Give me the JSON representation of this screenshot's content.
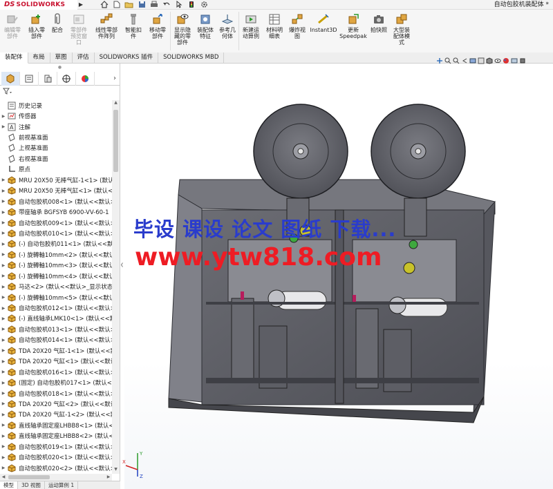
{
  "app": {
    "brand_prefix": "DS",
    "brand_name": "SOLIDWORKS",
    "document_title": "自动包胶机装配体 *"
  },
  "quick_tools": [
    "home-icon",
    "new-file-icon",
    "open-icon",
    "save-icon",
    "print-icon",
    "undo-icon",
    "select-arrow-icon",
    "rebuild-icon",
    "options-icon"
  ],
  "ribbon": {
    "buttons": [
      {
        "id": "edit-component",
        "label": "编辑零\n部件",
        "disabled": true
      },
      {
        "id": "insert-component",
        "label": "插入零\n部件",
        "disabled": false
      },
      {
        "id": "mate",
        "label": "配合",
        "disabled": false
      },
      {
        "id": "component-preview",
        "label": "零部件\n预览窗\n口",
        "disabled": true
      },
      {
        "id": "linear-pattern",
        "label": "线性零部\n件阵列",
        "disabled": false
      },
      {
        "id": "smart-fasteners",
        "label": "智能扣\n件",
        "disabled": false
      },
      {
        "id": "move-component",
        "label": "移动零\n部件",
        "disabled": false
      },
      {
        "id": "show-hidden",
        "label": "显示隐\n藏的零\n部件",
        "disabled": false
      },
      {
        "id": "assembly-features",
        "label": "装配体\n特征",
        "disabled": false
      },
      {
        "id": "reference-geometry",
        "label": "参考几\n何体",
        "disabled": false
      },
      {
        "id": "new-motion-study",
        "label": "新建运\n动算例",
        "disabled": false
      },
      {
        "id": "bill-of-materials",
        "label": "材料明\n细表",
        "disabled": false
      },
      {
        "id": "exploded-view",
        "label": "爆炸视\n图",
        "disabled": false
      },
      {
        "id": "instant3d",
        "label": "Instant3D",
        "disabled": false
      },
      {
        "id": "update-speedpak",
        "label": "更新\nSpeedpak",
        "disabled": false
      },
      {
        "id": "snapshot",
        "label": "拍快照",
        "disabled": false
      },
      {
        "id": "large-assembly-mode",
        "label": "大型装\n配体模\n式",
        "disabled": false
      }
    ]
  },
  "tabs": [
    {
      "label": "装配体",
      "active": true
    },
    {
      "label": "布局",
      "active": false
    },
    {
      "label": "草图",
      "active": false
    },
    {
      "label": "评估",
      "active": false
    },
    {
      "label": "SOLIDWORKS 插件",
      "active": false
    },
    {
      "label": "SOLIDWORKS MBD",
      "active": false
    }
  ],
  "panel_tabs": [
    "featuremanager-icon",
    "propertymanager-icon",
    "configurationmanager-icon",
    "dimxpert-icon",
    "display-manager-icon"
  ],
  "tree": {
    "items": [
      {
        "label": "历史记录",
        "icon": "history-icon",
        "expand": false
      },
      {
        "label": "传感器",
        "icon": "sensor-icon",
        "expand": true
      },
      {
        "label": "注解",
        "icon": "annotation-icon",
        "expand": true
      },
      {
        "label": "前视基准面",
        "icon": "plane-icon",
        "expand": false
      },
      {
        "label": "上视基准面",
        "icon": "plane-icon",
        "expand": false
      },
      {
        "label": "右视基准面",
        "icon": "plane-icon",
        "expand": false
      },
      {
        "label": "原点",
        "icon": "origin-icon",
        "expand": false
      },
      {
        "label": "MRU 20X50  无棒气缸-1<1> (默认",
        "icon": "part-icon",
        "expand": true
      },
      {
        "label": "MRU 20X50  无棒气缸<1> (默认<",
        "icon": "part-icon",
        "expand": true
      },
      {
        "label": "自动包胶机008<1> (默认<<默认>",
        "icon": "part-icon",
        "expand": true
      },
      {
        "label": "带座轴承 BGFSYB 6900-VV-60-1",
        "icon": "part-icon",
        "expand": true
      },
      {
        "label": "自动包胶机009<1> (默认<<默认>",
        "icon": "part-icon",
        "expand": true
      },
      {
        "label": "自动包胶机010<1> (默认<<默认>",
        "icon": "part-icon",
        "expand": true
      },
      {
        "label": "(-) 自动包胶机011<1> (默认<<默",
        "icon": "part-icon",
        "expand": true
      },
      {
        "label": "(-) 旋轉軸10mm<2> (默认<<默认",
        "icon": "part-icon",
        "expand": true
      },
      {
        "label": "(-) 旋轉軸10mm<3> (默认<<默认",
        "icon": "part-icon",
        "expand": true
      },
      {
        "label": "(-) 旋轉軸10mm<4> (默认<<默认",
        "icon": "part-icon",
        "expand": true
      },
      {
        "label": "马达<2> (默认<<默认>_显示状态",
        "icon": "part-icon",
        "expand": true
      },
      {
        "label": "(-) 旋轉軸10mm<5> (默认<<默认",
        "icon": "part-icon",
        "expand": true
      },
      {
        "label": "自动包胶机012<1> (默认<<默认>",
        "icon": "part-icon",
        "expand": true
      },
      {
        "label": "(-) 直线轴承LMK10<1> (默认<<默",
        "icon": "part-icon",
        "expand": true
      },
      {
        "label": "自动包胶机013<1> (默认<<默认>",
        "icon": "part-icon",
        "expand": true
      },
      {
        "label": "自动包胶机014<1> (默认<<默认>",
        "icon": "part-icon",
        "expand": true
      },
      {
        "label": "TDA 20X20 气缸-1<1> (默认<<默",
        "icon": "part-icon",
        "expand": true
      },
      {
        "label": "TDA 20X20 气缸<1> (默认<<默认",
        "icon": "part-icon",
        "expand": true
      },
      {
        "label": "自动包胶机016<1> (默认<<默认>",
        "icon": "part-icon",
        "expand": true
      },
      {
        "label": "(固定) 自动包胶机017<1> (默认<<",
        "icon": "part-icon",
        "expand": true
      },
      {
        "label": "自动包胶机018<1> (默认<<默认>",
        "icon": "part-icon",
        "expand": true
      },
      {
        "label": "TDA 20X20 气缸<2> (默认<<默认",
        "icon": "part-icon",
        "expand": true
      },
      {
        "label": "TDA 20X20 气缸-1<2> (默认<<默",
        "icon": "part-icon",
        "expand": true
      },
      {
        "label": "直线轴承固定座LHBB8<1> (默认<<",
        "icon": "part-icon",
        "expand": true
      },
      {
        "label": "直线轴承固定座LHBB8<2> (默认<<",
        "icon": "part-icon",
        "expand": true
      },
      {
        "label": "自动包胶机019<1> (默认<<默认>",
        "icon": "part-icon",
        "expand": true
      },
      {
        "label": "自动包胶机020<1> (默认<<默认>",
        "icon": "part-icon",
        "expand": true
      },
      {
        "label": "自动包胶机020<2> (默认<<默认>",
        "icon": "part-icon",
        "expand": true
      }
    ]
  },
  "bottom_tabs": [
    {
      "label": "模型",
      "active": true
    },
    {
      "label": "3D 视图",
      "active": false
    },
    {
      "label": "运动算例 1",
      "active": false
    }
  ],
  "watermark": {
    "line1": "毕设 课设 论文 图纸 下载...",
    "line2": "www.ytw818.com",
    "color1": "#2a3ccc",
    "color2": "#ee1c24"
  },
  "triad": {
    "x_label": "X",
    "y_label": "Y",
    "z_label": "Z"
  },
  "colors": {
    "brand": "#c8102e",
    "model_body": "#5e5f66",
    "selection_blue": "#dde8f6"
  }
}
